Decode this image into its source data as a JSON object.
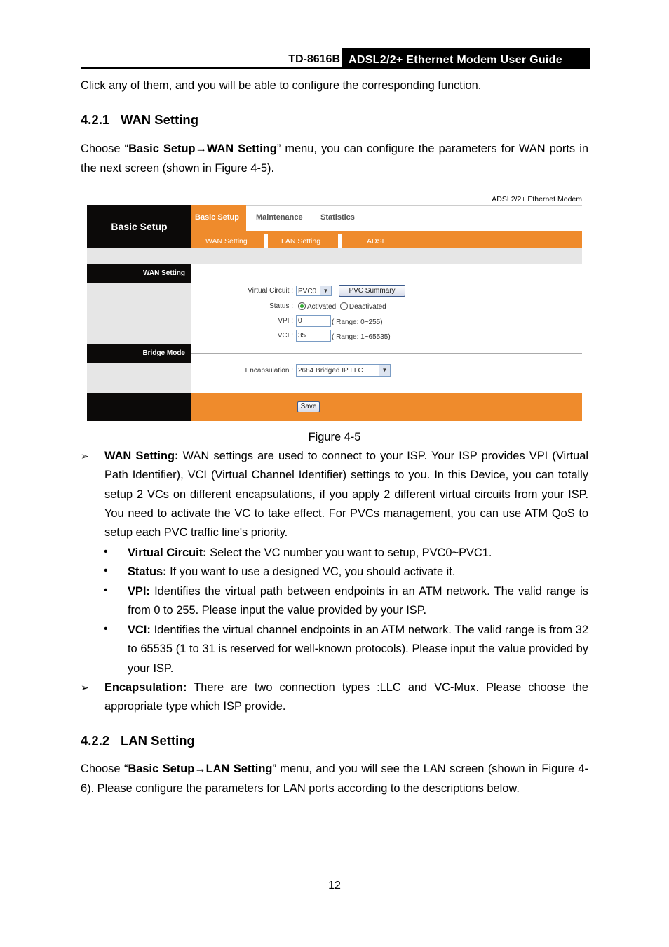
{
  "header": {
    "model": "TD-8616B",
    "title": "ADSL2/2+ Ethernet Modem User Guide"
  },
  "intro": "Click any of them, and you will be able to configure the corresponding function.",
  "section1": {
    "number": "4.2.1",
    "title": "WAN Setting",
    "para": {
      "pre": "Choose “",
      "bold1": "Basic Setup",
      "arrow": "→",
      "bold2": "WAN Setting",
      "post": "” menu, you can configure the parameters for WAN ports in the next screen (shown in Figure 4-5)."
    }
  },
  "screenshot": {
    "brand": "ADSL2/2+ Ethernet Modem",
    "section_label": "Basic Setup",
    "tabs": [
      "Basic Setup",
      "Maintenance",
      "Statistics"
    ],
    "subtabs": [
      "WAN Setting",
      "LAN Setting",
      "ADSL"
    ],
    "side": [
      "WAN Setting",
      "Bridge Mode"
    ],
    "vc_label": "Virtual Circuit :",
    "vc_value": "PVC0",
    "pvc_summary": "PVC Summary",
    "status_label": "Status :",
    "status_options": [
      "Activated",
      "Deactivated"
    ],
    "status_selected": "Activated",
    "vpi_label": "VPI :",
    "vpi_value": "0",
    "vpi_range": "( Range: 0~255)",
    "vci_label": "VCI :",
    "vci_value": "35",
    "vci_range": "( Range: 1~65535)",
    "encap_label": "Encapsulation :",
    "encap_value": "2684 Bridged IP LLC",
    "save": "Save",
    "colors": {
      "orange": "#ef8b2c",
      "black": "#0c0a09",
      "gray": "#e6e6e6"
    }
  },
  "figure_caption": "Figure 4-5",
  "bullets": [
    {
      "bold": "WAN Setting:",
      "text": " WAN settings are used to connect to your ISP. Your ISP provides VPI (Virtual Path Identifier), VCI (Virtual Channel Identifier) settings to you. In this Device, you can totally setup 2 VCs on different encapsulations, if you apply 2 different virtual circuits from your ISP. You need to activate the VC to take effect. For PVCs management, you can use ATM QoS to setup each PVC traffic line's priority."
    },
    {
      "bold": "Encapsulation:",
      "text": " There are two connection types :LLC and VC-Mux. Please choose the appropriate type which ISP provide."
    }
  ],
  "subbullets": [
    {
      "bold": "Virtual Circuit:",
      "text": " Select the VC number you want to setup, PVC0~PVC1."
    },
    {
      "bold": "Status:",
      "text": " If you want to use a designed VC, you should activate it."
    },
    {
      "bold": "VPI:",
      "text": " Identifies the virtual path between endpoints in an ATM network. The valid range is from 0 to 255. Please input the value provided by your ISP."
    },
    {
      "bold": "VCI:",
      "text": " Identifies the virtual channel endpoints in an ATM network. The valid range is from 32 to 65535 (1 to 31 is reserved for well-known protocols). Please input the value provided by your ISP."
    }
  ],
  "section2": {
    "number": "4.2.2",
    "title": "LAN Setting",
    "para": {
      "pre": "Choose “",
      "bold1": "Basic Setup",
      "arrow": "→",
      "bold2": "LAN Setting",
      "post": "” menu, and you will see the LAN screen (shown in Figure 4-6). Please configure the parameters for LAN ports according to the descriptions below."
    }
  },
  "page_number": "12"
}
